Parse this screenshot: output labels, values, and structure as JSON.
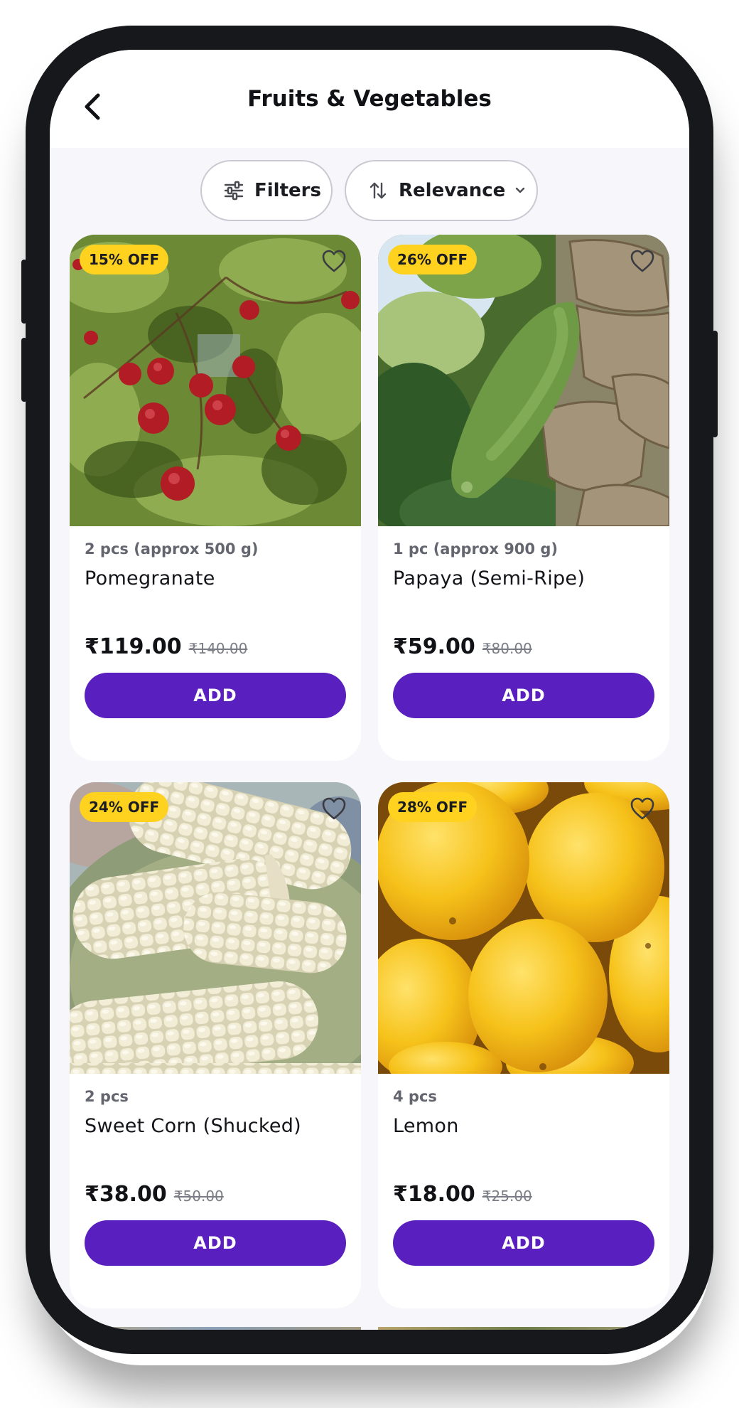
{
  "header": {
    "title": "Fruits & Vegetables"
  },
  "toolbar": {
    "filters_label": "Filters",
    "sort_label": "Relevance"
  },
  "colors": {
    "accent": "#5a1fbf",
    "badge": "#ffd21f",
    "background": "#f7f6fb"
  },
  "products": [
    {
      "discount": "15% OFF",
      "quantity": "2 pcs (approx 500 g)",
      "name": "Pomegranate",
      "price": "₹119.00",
      "mrp": "₹140.00",
      "add_label": "ADD",
      "image": "pomegranate-tree-photo"
    },
    {
      "discount": "26% OFF",
      "quantity": "1 pc (approx 900 g)",
      "name": "Papaya (Semi-Ripe)",
      "price": "₹59.00",
      "mrp": "₹80.00",
      "add_label": "ADD",
      "image": "green-papaya-photo"
    },
    {
      "discount": "24% OFF",
      "quantity": "2 pcs",
      "name": "Sweet Corn (Shucked)",
      "price": "₹38.00",
      "mrp": "₹50.00",
      "add_label": "ADD",
      "image": "sweet-corn-photo"
    },
    {
      "discount": "28% OFF",
      "quantity": "4 pcs",
      "name": "Lemon",
      "price": "₹18.00",
      "mrp": "₹25.00",
      "add_label": "ADD",
      "image": "lemons-photo"
    }
  ]
}
